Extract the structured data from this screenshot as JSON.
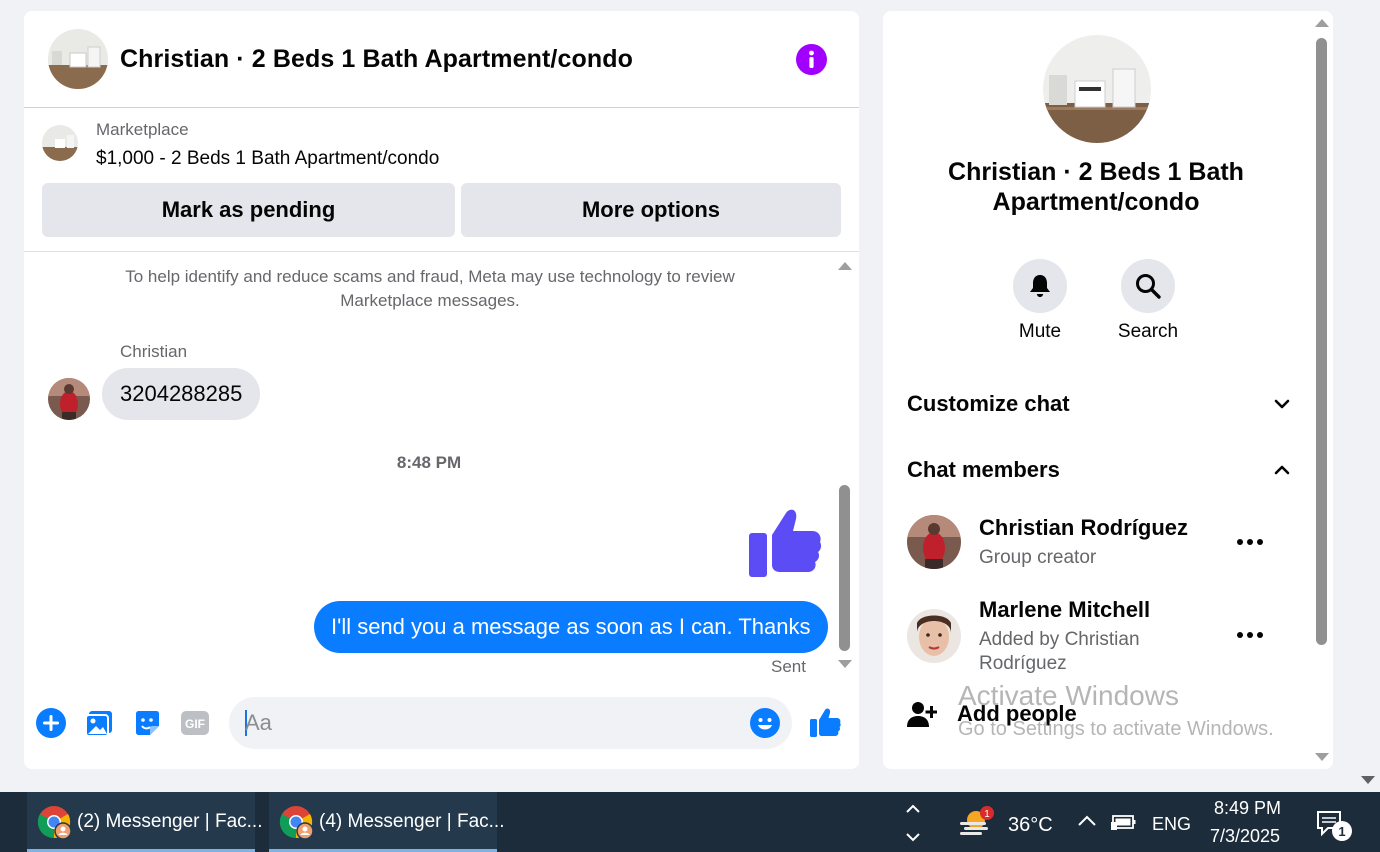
{
  "chat": {
    "title": "Christian · 2 Beds 1 Bath Apartment/condo",
    "listing": {
      "category": "Marketplace",
      "title": "$1,000 - 2 Beds 1 Bath Apartment/condo",
      "mark_pending_label": "Mark as pending",
      "more_options_label": "More options"
    },
    "notice": "To help identify and reduce scams and fraud, Meta may use technology to review Marketplace messages.",
    "messages": {
      "sender_name": "Christian",
      "incoming_text": "3204288285",
      "timestamp": "8:48 PM",
      "outgoing_text": "I'll send you a message as soon as I can. Thanks",
      "status": "Sent"
    },
    "composer": {
      "placeholder": "Aa",
      "gif_label": "GIF"
    }
  },
  "info": {
    "title": "Christian · 2 Beds 1 Bath Apartment/condo",
    "mute_label": "Mute",
    "search_label": "Search",
    "customize_label": "Customize chat",
    "members_label": "Chat members",
    "members": [
      {
        "name": "Christian Rodríguez",
        "role": "Group creator"
      },
      {
        "name": "Marlene Mitchell",
        "role": "Added by Christian Rodríguez"
      }
    ],
    "add_people_label": "Add people"
  },
  "watermark": {
    "line1": "Activate Windows",
    "line2": "Go to Settings to activate Windows."
  },
  "taskbar": {
    "tasks": [
      {
        "label": "(2) Messenger | Fac..."
      },
      {
        "label": "(4) Messenger | Fac..."
      }
    ],
    "weather_badge": "1",
    "temperature": "36°C",
    "language": "ENG",
    "time": "8:49 PM",
    "date": "7/3/2025",
    "notification_count": "1"
  },
  "colors": {
    "messenger_blue": "#0a7cff",
    "like_purple": "#5b4cf5",
    "info_purple": "#a100ff",
    "taskbar_bg": "#1c2c3a"
  }
}
